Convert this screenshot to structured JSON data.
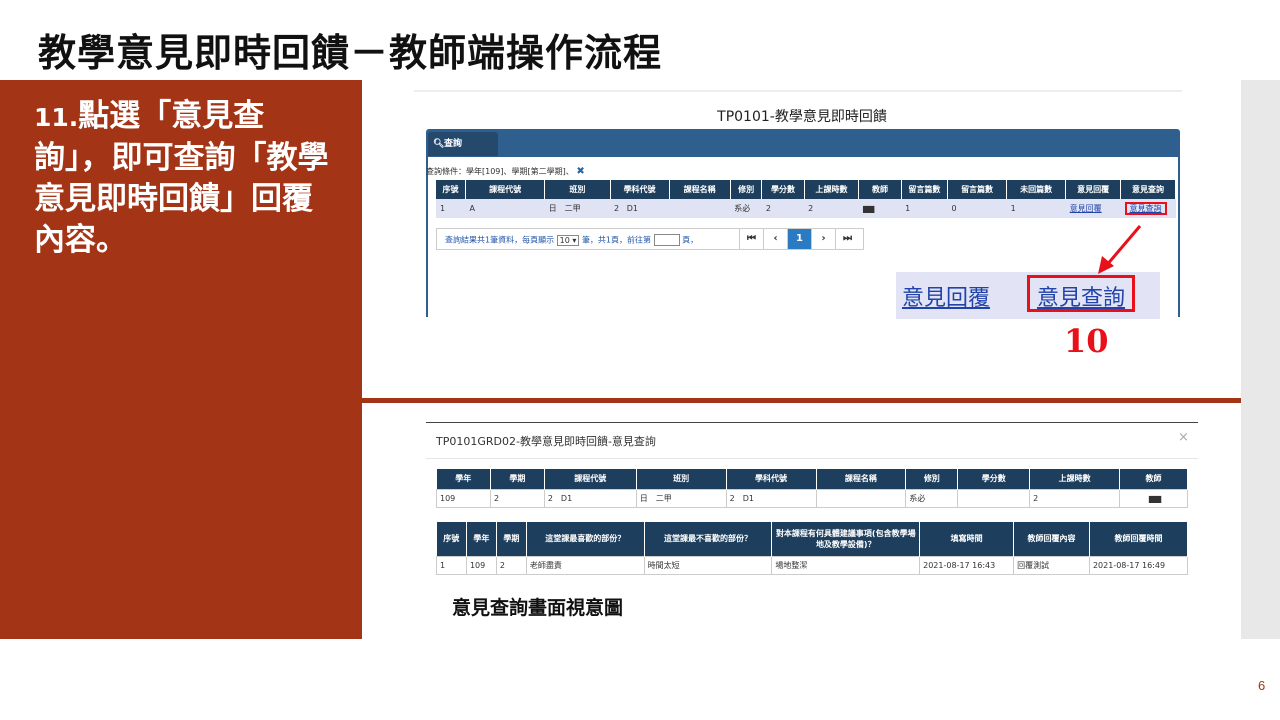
{
  "slide": {
    "title": "教學意見即時回饋－教師端操作流程",
    "step_number": "11.",
    "step_text": "點選「意見查詢」，即可查詢「教學意見即時回饋」回覆內容。",
    "caption": "意見查詢畫面視意圖",
    "page_number": "6"
  },
  "screen1": {
    "title": "TP0101-教學意見即時回饋",
    "tab_label": "查詢",
    "condition_text": "查詢條件：學年[109]、學期[第二學期]、",
    "condition_clear": "✖",
    "headers": [
      "序號",
      "課程代號",
      "班別",
      "學科代號",
      "課程名稱",
      "修別",
      "學分數",
      "上課時數",
      "教師",
      "留言篇數",
      "留言篇數",
      "未回篇數",
      "意見回覆",
      "意見查詢"
    ],
    "row": [
      "1",
      "A",
      "日　二甲",
      "2",
      "D1",
      "",
      "系必",
      "2",
      "2",
      "",
      "1",
      "0",
      "1",
      "意見回覆",
      "意見查詢"
    ],
    "pager": {
      "prefix": "查詢結果共1筆資料，每頁顯示",
      "page_size": "10",
      "suffix": "筆，共1頁，前往第",
      "page_suffix": "頁，",
      "first": "⏮",
      "prev": "‹",
      "current": "1",
      "next": "›",
      "last": "⏭"
    },
    "zoom_reply": "意見回覆",
    "zoom_query": "意見查詢",
    "annotation_number": "10"
  },
  "screen2": {
    "title": "TP0101GRD02-教學意見即時回饋-意見查詢",
    "close": "×",
    "info_headers": [
      "學年",
      "學期",
      "課程代號",
      "班別",
      "學科代號",
      "課程名稱",
      "修別",
      "學分數",
      "上課時數",
      "教師"
    ],
    "info_row": [
      "109",
      "2",
      "2　D1",
      "日　二甲",
      "2　D1",
      "",
      "系必",
      "",
      "2",
      ""
    ],
    "feedback_headers": [
      "序號",
      "學年",
      "學期",
      "這堂課最喜歡的部份？",
      "這堂課最不喜歡的部份？",
      "對本課程有何具體建議事項(包含教學場地及教學設備)？",
      "填寫時間",
      "教師回覆內容",
      "教師回覆時間"
    ],
    "feedback_row": [
      "1",
      "109",
      "2",
      "老師盡責",
      "時間太短",
      "場地整潔",
      "2021-08-17 16:43",
      "回覆測試",
      "2021-08-17 16:49"
    ]
  }
}
